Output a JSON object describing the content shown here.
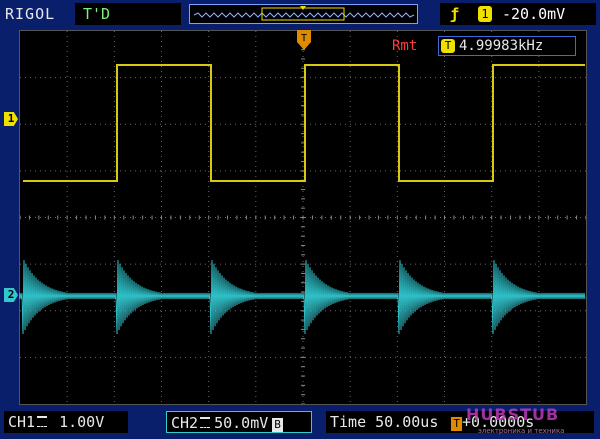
{
  "topbar": {
    "brand": "RIGOL",
    "mode": "T'D",
    "trigger": {
      "edge_icon": "rising-edge-icon",
      "channel": "1",
      "level": "-20.0mV"
    }
  },
  "screen": {
    "ch1_marker": "1",
    "ch2_marker": "2",
    "trigger_pos_marker": "T",
    "rmt_label": "Rmt",
    "freq_icon": "T",
    "frequency": "4.99983kHz"
  },
  "bottombar": {
    "ch1": {
      "label": "CH1",
      "scale": "1.00V"
    },
    "ch2": {
      "label": "CH2",
      "scale": "50.0mV",
      "coupling_badge": "B"
    },
    "time": {
      "label": "Time",
      "scale": "50.00us",
      "offset": "+0.0000s",
      "offset_icon": "T"
    }
  },
  "watermark": {
    "text": "HUBSTUB",
    "subtext": "электроника и техника"
  },
  "colors": {
    "ch1": "#d8c814",
    "ch2": "#2fc0c8",
    "frame": "#0a1f6b",
    "grid": "#8a8a8a"
  }
}
